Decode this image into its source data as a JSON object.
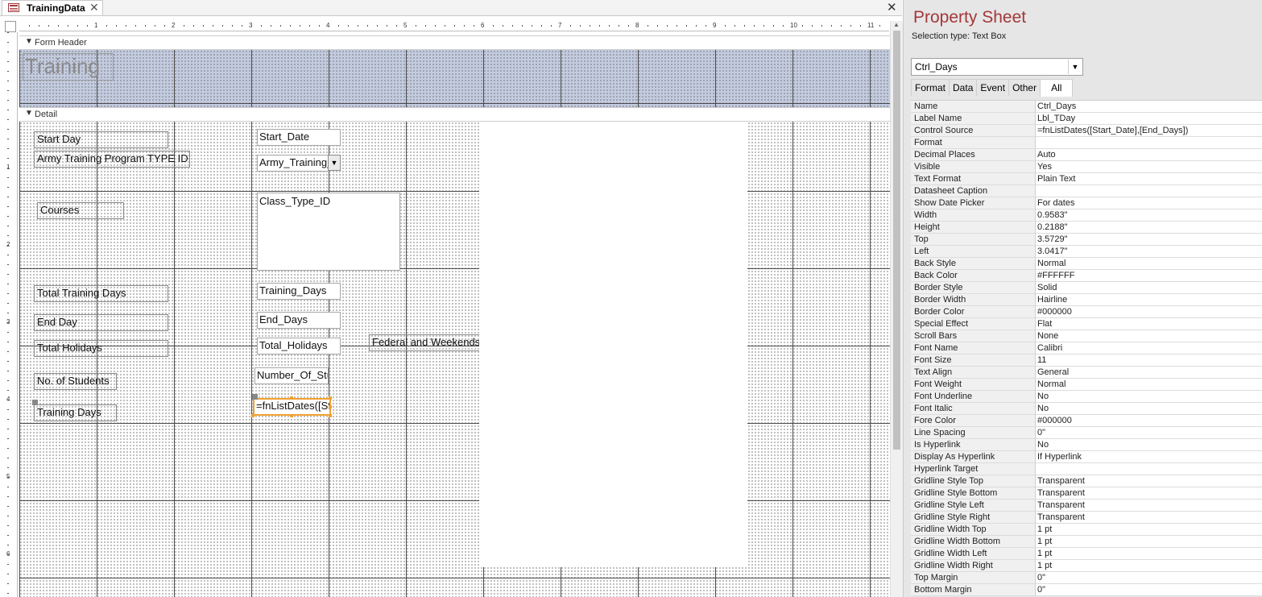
{
  "document_tab": {
    "title": "TrainingData",
    "close_glyph": "✕"
  },
  "window_close_glyph": "✕",
  "ruler": {
    "top_numbers": [
      "1",
      "2",
      "3",
      "4",
      "5",
      "6",
      "7",
      "8",
      "9",
      "10",
      "11"
    ],
    "left_numbers": [
      "1",
      "2",
      "3",
      "4",
      "5",
      "6"
    ]
  },
  "sections": {
    "form_header": "Form Header",
    "detail": "Detail"
  },
  "form_title": "Training",
  "labels": {
    "start_day": "Start Day",
    "army_program": "Army Training Program TYPE ID",
    "courses": "Courses",
    "total_training_days": "Total Training Days",
    "end_day": "End Day",
    "total_holidays": "Total Holidays",
    "no_students": "No. of Students",
    "training_days": "Training Days",
    "federal": "Federal and Weekends"
  },
  "textboxes": {
    "start_date": "Start_Date",
    "army_training": "Army_Training_Program_TYPE_ID",
    "class_type_id": "Class_Type_ID",
    "training_days": "Training_Days",
    "end_days": "End_Days",
    "total_holidays": "Total_Holidays",
    "number_of_students": "Number_Of_Students",
    "ctrl_days": "=fnListDates([Start_Date],[End_Days])"
  },
  "property_sheet": {
    "title": "Property Sheet",
    "selection_type": "Selection type:  Text Box",
    "selected_control": "Ctrl_Days",
    "tabs": [
      "Format",
      "Data",
      "Event",
      "Other",
      "All"
    ],
    "active_tab": "All",
    "properties": [
      {
        "name": "Name",
        "value": "Ctrl_Days"
      },
      {
        "name": "Label Name",
        "value": "Lbl_TDay"
      },
      {
        "name": "Control Source",
        "value": "=fnListDates([Start_Date],[End_Days])"
      },
      {
        "name": "Format",
        "value": ""
      },
      {
        "name": "Decimal Places",
        "value": "Auto"
      },
      {
        "name": "Visible",
        "value": "Yes"
      },
      {
        "name": "Text Format",
        "value": "Plain Text"
      },
      {
        "name": "Datasheet Caption",
        "value": ""
      },
      {
        "name": "Show Date Picker",
        "value": "For dates"
      },
      {
        "name": "Width",
        "value": "0.9583\""
      },
      {
        "name": "Height",
        "value": "0.2188\""
      },
      {
        "name": "Top",
        "value": "3.5729\""
      },
      {
        "name": "Left",
        "value": "3.0417\""
      },
      {
        "name": "Back Style",
        "value": "Normal"
      },
      {
        "name": "Back Color",
        "value": "#FFFFFF"
      },
      {
        "name": "Border Style",
        "value": "Solid"
      },
      {
        "name": "Border Width",
        "value": "Hairline"
      },
      {
        "name": "Border Color",
        "value": "#000000"
      },
      {
        "name": "Special Effect",
        "value": "Flat"
      },
      {
        "name": "Scroll Bars",
        "value": "None"
      },
      {
        "name": "Font Name",
        "value": "Calibri"
      },
      {
        "name": "Font Size",
        "value": "11"
      },
      {
        "name": "Text Align",
        "value": "General"
      },
      {
        "name": "Font Weight",
        "value": "Normal"
      },
      {
        "name": "Font Underline",
        "value": "No"
      },
      {
        "name": "Font Italic",
        "value": "No"
      },
      {
        "name": "Fore Color",
        "value": "#000000"
      },
      {
        "name": "Line Spacing",
        "value": "0\""
      },
      {
        "name": "Is Hyperlink",
        "value": "No"
      },
      {
        "name": "Display As Hyperlink",
        "value": "If Hyperlink"
      },
      {
        "name": "Hyperlink Target",
        "value": ""
      },
      {
        "name": "Gridline Style Top",
        "value": "Transparent"
      },
      {
        "name": "Gridline Style Bottom",
        "value": "Transparent"
      },
      {
        "name": "Gridline Style Left",
        "value": "Transparent"
      },
      {
        "name": "Gridline Style Right",
        "value": "Transparent"
      },
      {
        "name": "Gridline Width Top",
        "value": "1 pt"
      },
      {
        "name": "Gridline Width Bottom",
        "value": "1 pt"
      },
      {
        "name": "Gridline Width Left",
        "value": "1 pt"
      },
      {
        "name": "Gridline Width Right",
        "value": "1 pt"
      },
      {
        "name": "Top Margin",
        "value": "0\""
      },
      {
        "name": "Bottom Margin",
        "value": "0\""
      }
    ]
  },
  "colors": {
    "accent": "#A4373A",
    "header_band": "#C3CBE0",
    "selection": "#F0A030"
  }
}
